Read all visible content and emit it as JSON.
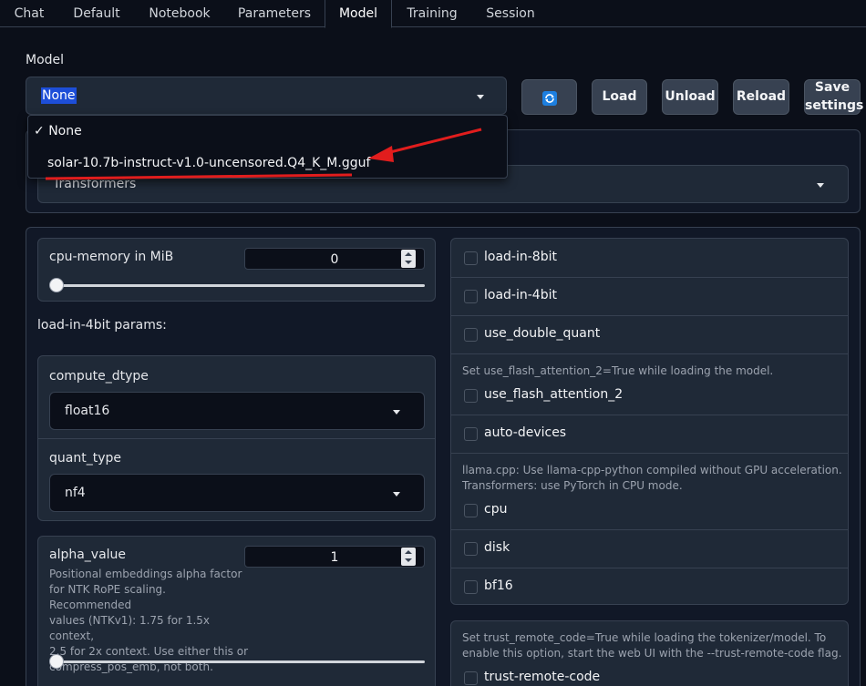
{
  "tabs": [
    {
      "label": "Chat"
    },
    {
      "label": "Default"
    },
    {
      "label": "Notebook"
    },
    {
      "label": "Parameters"
    },
    {
      "label": "Model"
    },
    {
      "label": "Training"
    },
    {
      "label": "Session"
    }
  ],
  "model": {
    "label": "Model",
    "selected": "None",
    "options": [
      "None",
      "solar-10.7b-instruct-v1.0-uncensored.Q4_K_M.gguf"
    ],
    "checkmark": "✓"
  },
  "buttons": {
    "load": "Load",
    "unload": "Unload",
    "reload": "Reload",
    "save_line1": "Save",
    "save_line2": "settings"
  },
  "loader": {
    "selected": "Transformers"
  },
  "cpu_memory": {
    "label": "cpu-memory in MiB",
    "value": "0",
    "fraction": 0
  },
  "params_heading": "load-in-4bit params:",
  "compute_dtype": {
    "label": "compute_dtype",
    "value": "float16"
  },
  "quant_type": {
    "label": "quant_type",
    "value": "nf4"
  },
  "alpha": {
    "label": "alpha_value",
    "value": "1",
    "fraction": 0,
    "desc_lines": [
      "Positional embeddings alpha factor",
      "for NTK RoPE scaling. Recommended",
      "values (NTKv1): 1.75 for 1.5x context,",
      "2.5 for 2x context. Use either this or",
      "compress_pos_emb, not both."
    ]
  },
  "checkboxes": {
    "load_in_8bit": "load-in-8bit",
    "load_in_4bit": "load-in-4bit",
    "use_double_quant": "use_double_quant",
    "flash_info": "Set use_flash_attention_2=True while loading the model.",
    "use_flash_attention_2": "use_flash_attention_2",
    "auto_devices": "auto-devices",
    "cpu_info_1": "llama.cpp: Use llama-cpp-python compiled without GPU acceleration.",
    "cpu_info_2": "Transformers: use PyTorch in CPU mode.",
    "cpu": "cpu",
    "disk": "disk",
    "bf16": "bf16",
    "trust_info_1": "Set trust_remote_code=True while loading the tokenizer/model. To",
    "trust_info_2": "enable this option, start the web UI with the --trust-remote-code flag.",
    "trust_remote_code": "trust-remote-code"
  },
  "colors": {
    "accent": "#1d4ed8",
    "annotation": "#e11d1d",
    "background": "#0b0f19"
  }
}
